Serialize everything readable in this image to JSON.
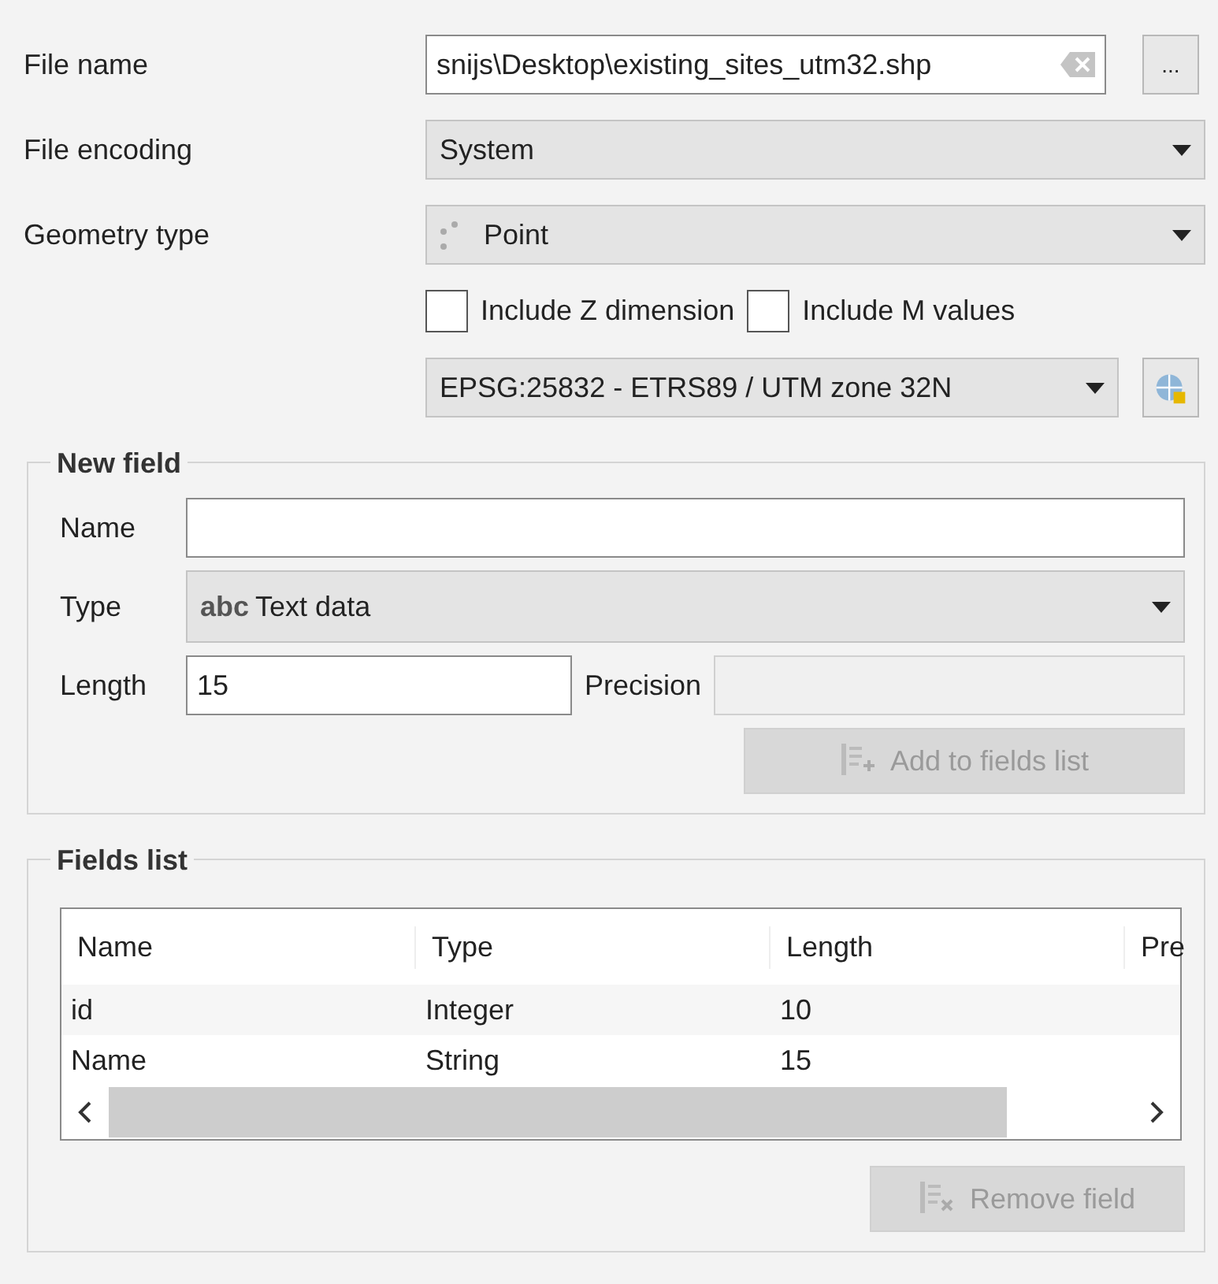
{
  "file_name": {
    "label": "File name",
    "value": "snijs\\Desktop\\existing_sites_utm32.shp",
    "browse": "..."
  },
  "file_encoding": {
    "label": "File encoding",
    "value": "System"
  },
  "geometry_type": {
    "label": "Geometry type",
    "value": "Point"
  },
  "options": [
    {
      "label": "Include Z dimension",
      "checked": false
    },
    {
      "label": "Include M values",
      "checked": false
    }
  ],
  "crs": {
    "value": "EPSG:25832 - ETRS89 / UTM zone 32N"
  },
  "new_field": {
    "title": "New field",
    "name_label": "Name",
    "type_label": "Type",
    "type_prefix": "abc",
    "type_value": "Text data",
    "length_label": "Length",
    "length_value": "15",
    "precision_label": "Precision",
    "precision_disabled": true,
    "add_button": {
      "label": "Add to fields list",
      "disabled": true
    }
  },
  "fields_list": {
    "title": "Fields list",
    "columns": [
      "Name",
      "Type",
      "Length",
      "Pre"
    ],
    "rows": [
      [
        "id",
        "Integer",
        "10"
      ],
      [
        "Name",
        "String",
        "15"
      ]
    ],
    "remove_button": {
      "label": "Remove field",
      "disabled": true
    }
  }
}
